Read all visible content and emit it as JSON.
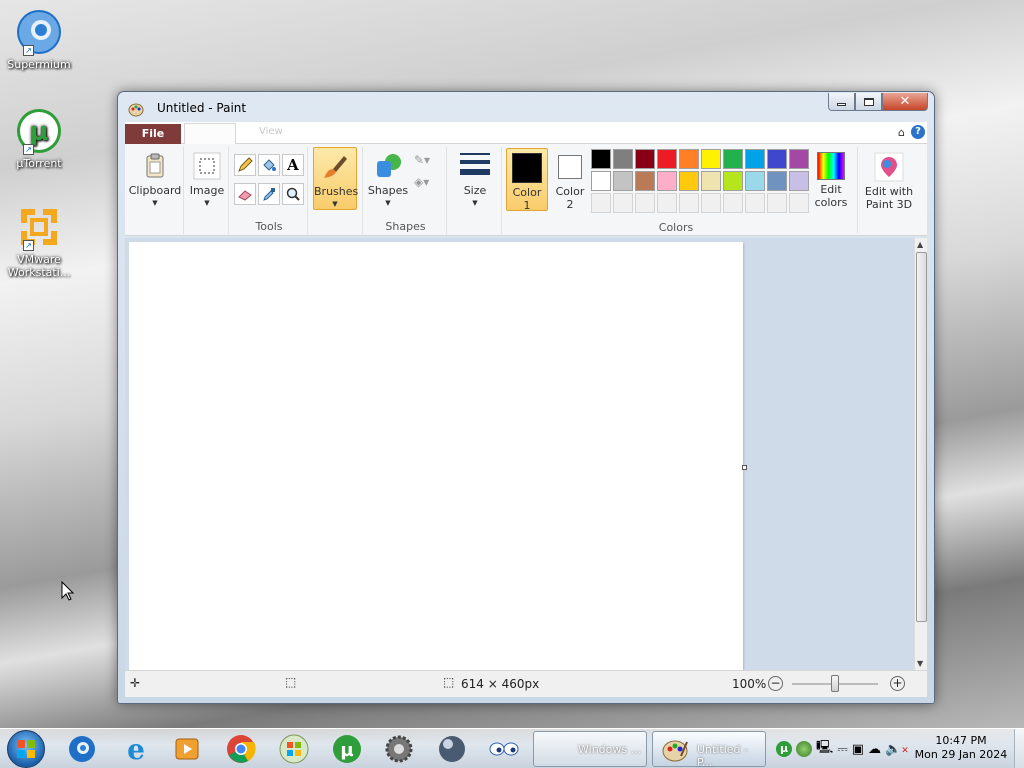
{
  "desktop": {
    "icons": [
      {
        "label": "Supermium"
      },
      {
        "label": "µTorrent"
      },
      {
        "label": "VMware Workstati..."
      }
    ]
  },
  "window": {
    "title": "Untitled - Paint",
    "controls": {
      "minimize": "minimize-icon",
      "maximize": "maximize-icon",
      "close": "close-icon"
    }
  },
  "ribbon": {
    "tabs": {
      "file": "File",
      "view": "View"
    },
    "groups": {
      "clipboard": {
        "label": "Clipboard"
      },
      "image": {
        "label": "Image"
      },
      "tools": {
        "label": "Tools"
      },
      "brushes": {
        "label": "Brushes"
      },
      "shapes": {
        "button": "Shapes",
        "label": "Shapes"
      },
      "size": {
        "label": "Size"
      },
      "color1": {
        "line1": "Color",
        "line2": "1",
        "value": "#000000"
      },
      "color2": {
        "line1": "Color",
        "line2": "2",
        "value": "#ffffff"
      },
      "colors_label": "Colors",
      "edit_colors": {
        "line1": "Edit",
        "line2": "colors"
      },
      "paint3d": {
        "line1": "Edit with",
        "line2": "Paint 3D"
      }
    },
    "palette_row1": [
      "#000000",
      "#7f7f7f",
      "#880015",
      "#ed1c24",
      "#ff7f27",
      "#fff200",
      "#22b14c",
      "#00a2e8",
      "#3f48cc",
      "#a349a4"
    ],
    "palette_row2": [
      "#ffffff",
      "#c3c3c3",
      "#b97a57",
      "#ffaec9",
      "#ffc90e",
      "#efe4b0",
      "#b5e61d",
      "#99d9ea",
      "#7092be",
      "#c8bfe7"
    ]
  },
  "status": {
    "dimensions": "614 × 460px",
    "zoom": "100%"
  },
  "taskbar": {
    "windows": [
      {
        "label": "Windows ..."
      },
      {
        "label": "Untitled - P..."
      }
    ],
    "clock": {
      "time": "10:47 PM",
      "date": "Mon 29 Jan 2024"
    }
  }
}
